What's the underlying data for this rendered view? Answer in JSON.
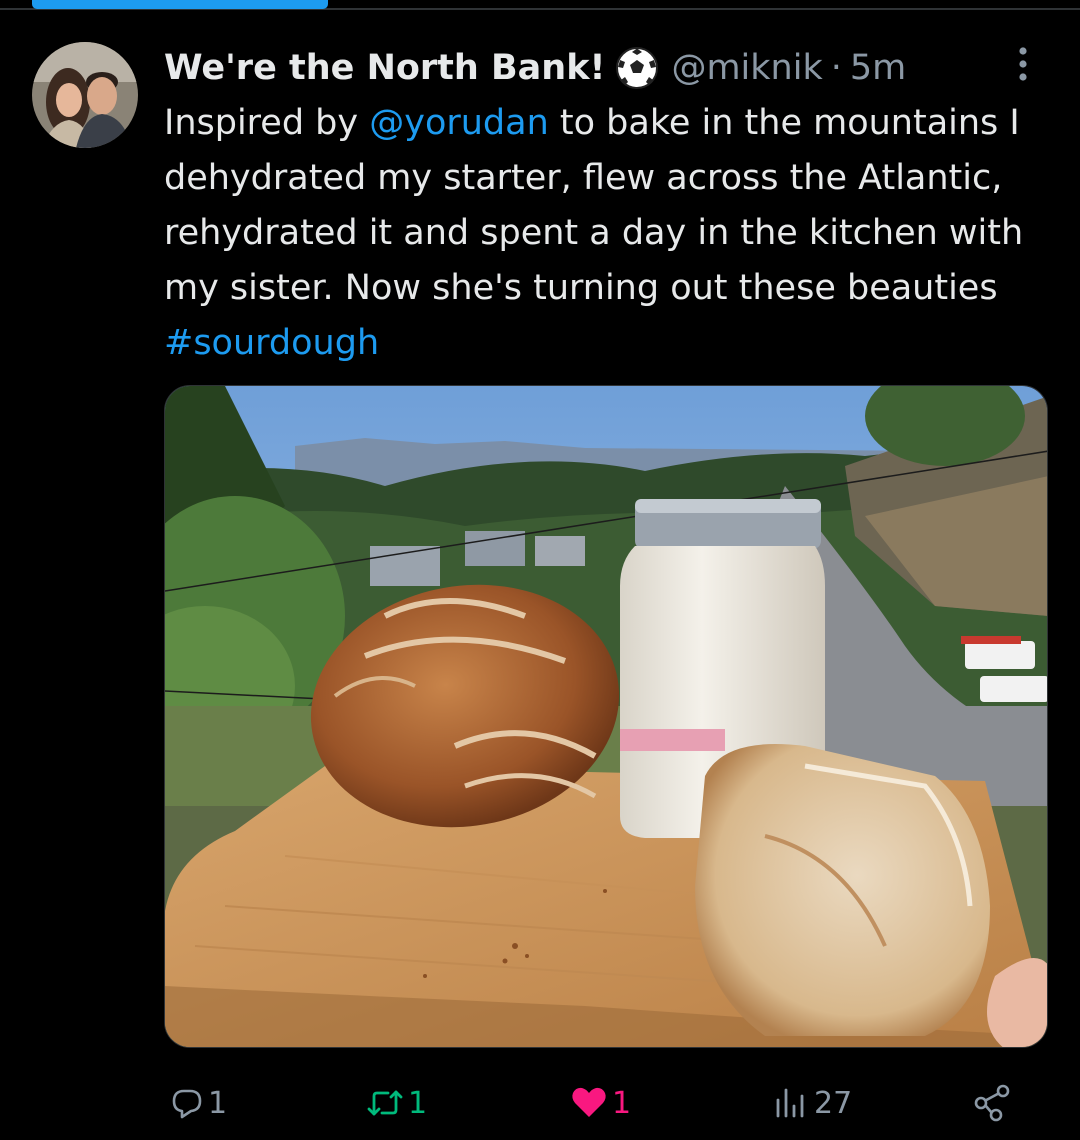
{
  "tweet": {
    "display_name": "We're the North Bank!",
    "badge_icon": "soccer-ball-icon",
    "handle": "@miknik",
    "separator": "·",
    "time": "5m",
    "text_parts": {
      "p1": "Inspired by ",
      "mention": "@yorudan",
      "p2": " to bake in the mountains I dehydrated my starter, flew across the Atlantic, rehydrated it and spent a day in the kitchen with my sister. Now she's turning out these beauties ",
      "hashtag": "#sourdough"
    }
  },
  "actions": {
    "reply_count": "1",
    "retweet_count": "1",
    "like_count": "1",
    "views_count": "27"
  },
  "colors": {
    "background": "#000000",
    "text": "#e7e9ea",
    "secondary": "#8b98a5",
    "link": "#1d9bf0",
    "retweet": "#00ba7c",
    "like": "#f91880"
  },
  "icons": {
    "reply": "reply-icon",
    "retweet": "retweet-icon",
    "like": "heart-icon",
    "views": "views-icon",
    "share": "share-icon",
    "more": "more-vertical-icon"
  }
}
